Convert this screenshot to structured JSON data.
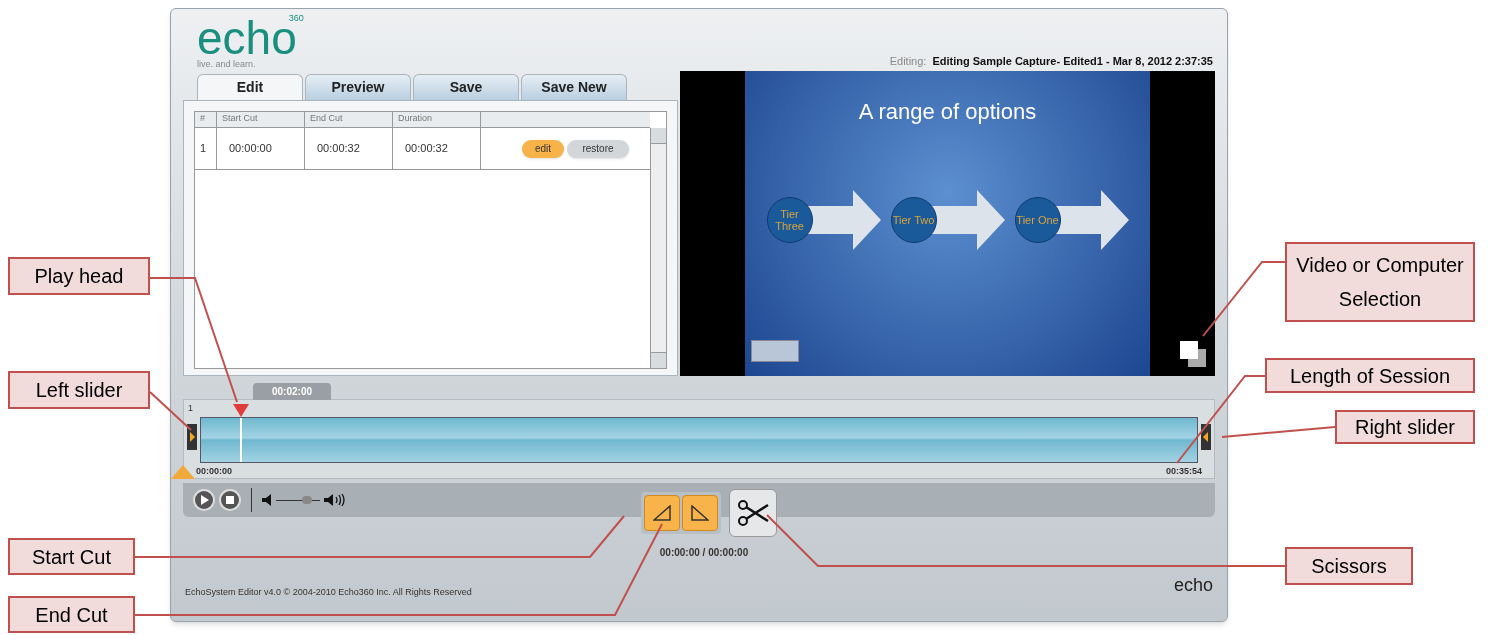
{
  "app": {
    "logo": {
      "wordmark": "echo",
      "superscript": "360",
      "tagline": "live. and learn."
    },
    "editing": {
      "label": "Editing:",
      "title": "Editing Sample Capture- Edited1 - Mar 8, 2012 2:37:35"
    },
    "tabs": [
      {
        "label": "Edit",
        "selected": true
      },
      {
        "label": "Preview",
        "selected": false
      },
      {
        "label": "Save",
        "selected": false
      },
      {
        "label": "Save New",
        "selected": false
      }
    ],
    "table": {
      "columns": [
        "#",
        "Start Cut",
        "End Cut",
        "Duration"
      ],
      "rows": [
        {
          "cells": [
            "1",
            "00:00:00",
            "00:00:32",
            "00:00:32"
          ],
          "buttons": [
            {
              "label": "edit",
              "kind": "primary"
            },
            {
              "label": "restore",
              "kind": "secondary"
            }
          ]
        }
      ]
    },
    "video": {
      "slide_title": "A range of options",
      "tiers": [
        "Tier Three",
        "Tier Two",
        "Tier One"
      ]
    },
    "timeline": {
      "playhead_time": "00:02:00",
      "playhead": {
        "level": 0.04
      },
      "track": "1",
      "start_time": "00:00:00",
      "end_time": "00:35:54"
    },
    "volume": {
      "level": 0.7
    },
    "cut_time": "00:00:00 / 00:00:00",
    "footer": {
      "copyright": "EchoSystem Editor v4.0 © 2004-2010 Echo360 Inc. All Rights Reserved",
      "logo": "echo"
    }
  },
  "callouts": [
    {
      "text": "Play head",
      "kind": "playhead"
    },
    {
      "text": "Left slider",
      "kind": "left"
    },
    {
      "text": "Video or Computer Selection",
      "kind": "video"
    },
    {
      "text": "Length of Session",
      "kind": "length"
    },
    {
      "text": "Right slider",
      "kind": "right"
    },
    {
      "text": "Start Cut",
      "kind": "start"
    },
    {
      "text": "Scissors",
      "kind": "scissors"
    },
    {
      "text": "End Cut",
      "kind": "end"
    }
  ]
}
